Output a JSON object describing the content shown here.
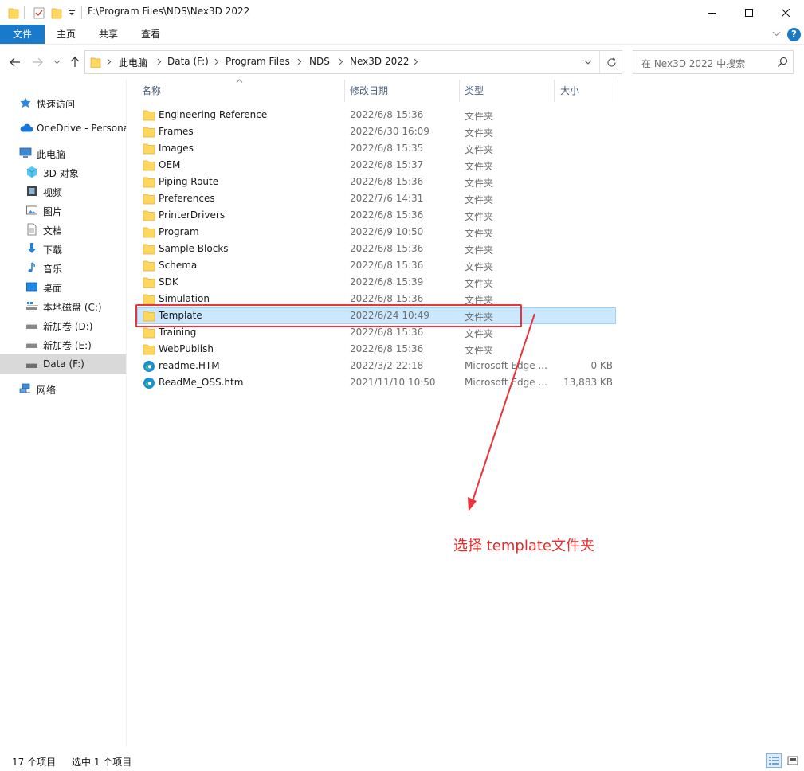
{
  "window": {
    "title": "F:\\Program Files\\NDS\\Nex3D 2022"
  },
  "ribbon": {
    "tabs": [
      "文件",
      "主页",
      "共享",
      "查看"
    ]
  },
  "address": {
    "crumbs": [
      "此电脑",
      "Data (F:)",
      "Program Files",
      "NDS",
      "Nex3D 2022"
    ],
    "search_placeholder": "在 Nex3D 2022 中搜索"
  },
  "sidebar": {
    "items": [
      {
        "label": "快速访问",
        "icon": "star-icon"
      },
      {
        "label": "OneDrive - Personal",
        "icon": "cloud-icon"
      },
      {
        "label": "此电脑",
        "icon": "computer-icon"
      },
      {
        "label": "3D 对象",
        "icon": "cube-icon"
      },
      {
        "label": "视频",
        "icon": "film-icon"
      },
      {
        "label": "图片",
        "icon": "picture-icon"
      },
      {
        "label": "文档",
        "icon": "document-icon"
      },
      {
        "label": "下载",
        "icon": "download-icon"
      },
      {
        "label": "音乐",
        "icon": "music-icon"
      },
      {
        "label": "桌面",
        "icon": "desktop-icon"
      },
      {
        "label": "本地磁盘 (C:)",
        "icon": "drive-icon"
      },
      {
        "label": "新加卷 (D:)",
        "icon": "drive-icon"
      },
      {
        "label": "新加卷 (E:)",
        "icon": "drive-icon"
      },
      {
        "label": "Data (F:)",
        "icon": "drive-icon"
      },
      {
        "label": "网络",
        "icon": "network-icon"
      }
    ]
  },
  "columns": {
    "name": "名称",
    "date": "修改日期",
    "type": "类型",
    "size": "大小"
  },
  "files": [
    {
      "name": "Engineering Reference",
      "date": "2022/6/8 15:36",
      "type": "文件夹",
      "size": "",
      "icon": "folder-icon"
    },
    {
      "name": "Frames",
      "date": "2022/6/30 16:09",
      "type": "文件夹",
      "size": "",
      "icon": "folder-icon"
    },
    {
      "name": "Images",
      "date": "2022/6/8 15:35",
      "type": "文件夹",
      "size": "",
      "icon": "folder-icon"
    },
    {
      "name": "OEM",
      "date": "2022/6/8 15:37",
      "type": "文件夹",
      "size": "",
      "icon": "folder-icon"
    },
    {
      "name": "Piping Route",
      "date": "2022/6/8 15:36",
      "type": "文件夹",
      "size": "",
      "icon": "folder-icon"
    },
    {
      "name": "Preferences",
      "date": "2022/7/6 14:31",
      "type": "文件夹",
      "size": "",
      "icon": "folder-icon"
    },
    {
      "name": "PrinterDrivers",
      "date": "2022/6/8 15:36",
      "type": "文件夹",
      "size": "",
      "icon": "folder-icon"
    },
    {
      "name": "Program",
      "date": "2022/6/9 10:50",
      "type": "文件夹",
      "size": "",
      "icon": "folder-icon"
    },
    {
      "name": "Sample Blocks",
      "date": "2022/6/8 15:36",
      "type": "文件夹",
      "size": "",
      "icon": "folder-icon"
    },
    {
      "name": "Schema",
      "date": "2022/6/8 15:36",
      "type": "文件夹",
      "size": "",
      "icon": "folder-icon"
    },
    {
      "name": "SDK",
      "date": "2022/6/8 15:39",
      "type": "文件夹",
      "size": "",
      "icon": "folder-icon"
    },
    {
      "name": "Simulation",
      "date": "2022/6/8 15:36",
      "type": "文件夹",
      "size": "",
      "icon": "folder-icon"
    },
    {
      "name": "Template",
      "date": "2022/6/24 10:49",
      "type": "文件夹",
      "size": "",
      "icon": "folder-icon",
      "selected": true
    },
    {
      "name": "Training",
      "date": "2022/6/8 15:36",
      "type": "文件夹",
      "size": "",
      "icon": "folder-icon"
    },
    {
      "name": "WebPublish",
      "date": "2022/6/8 15:36",
      "type": "文件夹",
      "size": "",
      "icon": "folder-icon"
    },
    {
      "name": "readme.HTM",
      "date": "2022/3/2 22:18",
      "type": "Microsoft Edge ...",
      "size": "0 KB",
      "icon": "edge-icon"
    },
    {
      "name": "ReadMe_OSS.htm",
      "date": "2021/11/10 10:50",
      "type": "Microsoft Edge ...",
      "size": "13,883 KB",
      "icon": "edge-icon"
    }
  ],
  "annotation": {
    "text": "选择 template文件夹",
    "color": "#e52b2b"
  },
  "status": {
    "count": "17 个项目",
    "selected": "选中 1 个项目"
  },
  "colors": {
    "accent": "#1979ca",
    "selection": "#cce8ff",
    "folder": "#ffd75e"
  }
}
